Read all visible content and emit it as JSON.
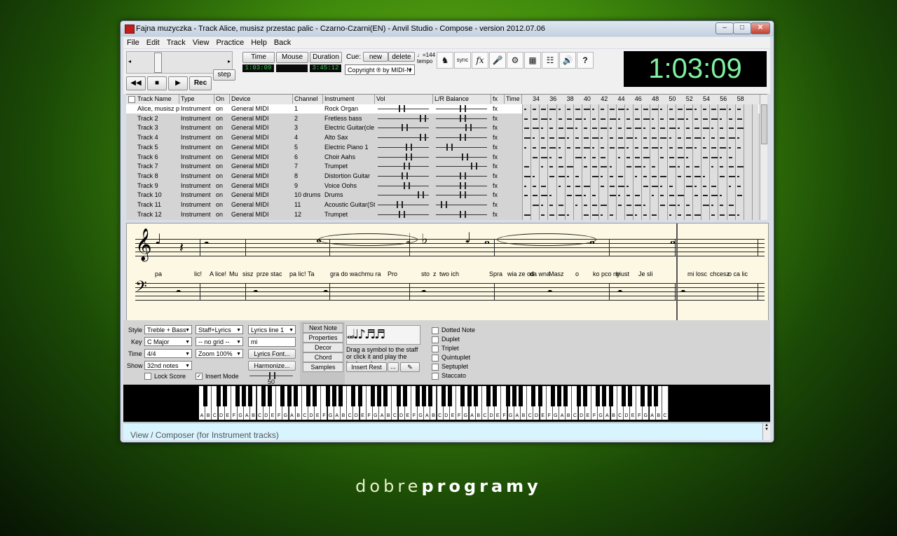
{
  "window": {
    "title": "Fajna muzyczka - Track Alice, musisz przestac palic - Czarno-Czarni(EN) - Anvil Studio - Compose - version 2012.07.06"
  },
  "menu": [
    "File",
    "Edit",
    "Track",
    "View",
    "Practice",
    "Help",
    "Back"
  ],
  "toolbar": {
    "time_label": "Time",
    "mouse_label": "Mouse",
    "duration_label": "Duration",
    "time_value": "1:03:09",
    "duration_value": "3:45:12",
    "rec_label": "Rec",
    "step_label": "step",
    "cue_label": "Cue:",
    "cue_new": "new",
    "cue_delete": "delete",
    "copyright": "Copyright ® by MIDI-N",
    "tempo_label": "♩=144 tempo",
    "clock": "1:03:09"
  },
  "track_headers": [
    "Track Name",
    "Type",
    "On",
    "Device",
    "Channel",
    "Instrument",
    "Vol",
    "L/R Balance",
    "fx",
    "Time"
  ],
  "timeline_measures": [
    "34",
    "36",
    "38",
    "40",
    "42",
    "44",
    "46",
    "48",
    "50",
    "52",
    "54",
    "56",
    "58"
  ],
  "tracks": [
    {
      "name": "Alice, musisz pr",
      "type": "Instrument",
      "on": "on",
      "device": "General MIDI",
      "channel": "1",
      "instrument": "Rock Organ",
      "vol": 0.45,
      "bal": 0.5,
      "fx": "fx"
    },
    {
      "name": "Track 2",
      "type": "Instrument",
      "on": "on",
      "device": "General MIDI",
      "channel": "2",
      "instrument": "Fretless bass",
      "vol": 0.9,
      "bal": 0.5,
      "fx": "fx"
    },
    {
      "name": "Track 3",
      "type": "Instrument",
      "on": "on",
      "device": "General MIDI",
      "channel": "3",
      "instrument": "Electric Guitar(cle",
      "vol": 0.5,
      "bal": 0.62,
      "fx": "fx"
    },
    {
      "name": "Track 4",
      "type": "Instrument",
      "on": "on",
      "device": "General MIDI",
      "channel": "4",
      "instrument": "Alto Sax",
      "vol": 0.9,
      "bal": 0.5,
      "fx": "fx"
    },
    {
      "name": "Track 5",
      "type": "Instrument",
      "on": "on",
      "device": "General MIDI",
      "channel": "5",
      "instrument": "Electric Piano 1",
      "vol": 0.6,
      "bal": 0.22,
      "fx": "fx"
    },
    {
      "name": "Track 6",
      "type": "Instrument",
      "on": "on",
      "device": "General MIDI",
      "channel": "6",
      "instrument": "Choir Aahs",
      "vol": 0.6,
      "bal": 0.55,
      "fx": "fx"
    },
    {
      "name": "Track 7",
      "type": "Instrument",
      "on": "on",
      "device": "General MIDI",
      "channel": "7",
      "instrument": "Trumpet",
      "vol": 0.55,
      "bal": 0.75,
      "fx": "fx"
    },
    {
      "name": "Track 8",
      "type": "Instrument",
      "on": "on",
      "device": "General MIDI",
      "channel": "8",
      "instrument": "Distortion Guitar",
      "vol": 0.5,
      "bal": 0.5,
      "fx": "fx"
    },
    {
      "name": "Track 9",
      "type": "Instrument",
      "on": "on",
      "device": "General MIDI",
      "channel": "9",
      "instrument": "Voice Oohs",
      "vol": 0.55,
      "bal": 0.5,
      "fx": "fx"
    },
    {
      "name": "Track 10",
      "type": "Instrument",
      "on": "on",
      "device": "General MIDI",
      "channel": "10 drums",
      "instrument": "Drums",
      "vol": 0.85,
      "bal": 0.5,
      "fx": "fx"
    },
    {
      "name": "Track 11",
      "type": "Instrument",
      "on": "on",
      "device": "General MIDI",
      "channel": "11",
      "instrument": "Acoustic Guitar(Ste",
      "vol": 0.4,
      "bal": 0.1,
      "fx": "fx"
    },
    {
      "name": "Track 12",
      "type": "Instrument",
      "on": "on",
      "device": "General MIDI",
      "channel": "12",
      "instrument": "Trumpet",
      "vol": 0.45,
      "bal": 0.5,
      "fx": "fx"
    }
  ],
  "lyrics": [
    "pa",
    "lic!",
    "A lice!",
    "Mu",
    "sisz",
    "prze stac",
    "pa lic!",
    "Ta",
    "gra do wa",
    "chmu ra",
    "Pro",
    "sto",
    "z",
    "two ich",
    "Spra",
    "wia ze od",
    "da wna",
    "Masz",
    "o",
    "ko pco ny",
    "biust",
    "Je sli",
    "mi losc",
    "chcesz",
    "o ca lic"
  ],
  "bottom": {
    "style_label": "Style",
    "key_label": "Key",
    "time_label": "Time",
    "show_label": "Show",
    "style_value": "Treble + Bass",
    "key_value": "C Major",
    "time_value": "4/4",
    "show_value": "32nd notes",
    "staff_value": "Staff+Lyrics",
    "grid_value": "-- no grid --",
    "zoom_value": "Zoom 100%",
    "lyrics_line": "Lyrics line 1",
    "lyrics_input": "mi",
    "lyrics_font": "Lyrics Font...",
    "harmonize": "Harmonize...",
    "lock_score": "Lock Score",
    "insert_mode": "Insert Mode",
    "slider_value": "50",
    "tabs": [
      "Next Note",
      "Properties",
      "Decor",
      "Chord",
      "Samples"
    ],
    "hint": "Drag a symbol to the staff or click it and play the keyboard",
    "insert_rest": "Insert Rest",
    "ellipsis": "...",
    "checkboxes": [
      "Dotted Note",
      "Duplet",
      "Triplet",
      "Quintuplet",
      "Septuplet",
      "Staccato"
    ]
  },
  "piano_keys": [
    "A",
    "B",
    "C",
    "D",
    "E",
    "F",
    "G",
    "A",
    "B",
    "C",
    "D",
    "E",
    "F",
    "G",
    "A",
    "B",
    "C",
    "D",
    "E",
    "F",
    "G",
    "A",
    "B",
    "C",
    "D",
    "E",
    "F",
    "G",
    "A",
    "B",
    "C",
    "D",
    "E",
    "F",
    "G",
    "A",
    "B",
    "C",
    "D",
    "E",
    "F",
    "G",
    "A",
    "B",
    "C",
    "D",
    "E",
    "F",
    "G",
    "A",
    "B",
    "C",
    "D",
    "E",
    "F",
    "G",
    "A",
    "B",
    "C",
    "D",
    "E",
    "F",
    "G",
    "A",
    "B",
    "C",
    "D",
    "E",
    "F",
    "G",
    "A",
    "B",
    "C"
  ],
  "status": "View / Composer (for Instrument tracks)",
  "brand": {
    "light": "dobre",
    "bold": "programy"
  }
}
